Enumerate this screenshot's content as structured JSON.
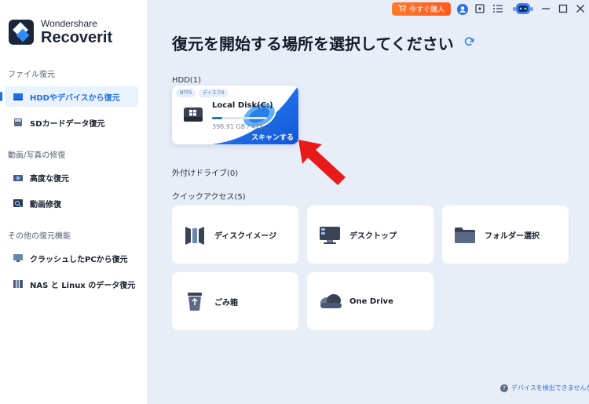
{
  "brand": {
    "line1": "Wondershare",
    "line2": "Recoverit"
  },
  "sidebar": {
    "sections": [
      {
        "title": "ファイル復元"
      },
      {
        "title": "動画/写真の修復"
      },
      {
        "title": "その他の復元機能"
      }
    ],
    "items": [
      {
        "label": "HDDやデバイスから復元",
        "icon": "hard-drive-icon",
        "active": true
      },
      {
        "label": "SDカードデータ復元",
        "icon": "sd-card-icon"
      },
      {
        "label": "高度な復元",
        "icon": "camera-icon"
      },
      {
        "label": "動画修復",
        "icon": "video-repair-icon"
      },
      {
        "label": "クラッシュしたPCから復元",
        "icon": "monitor-icon"
      },
      {
        "label": "NAS と Linux のデータ復元",
        "icon": "nas-icon"
      }
    ]
  },
  "topbar": {
    "buy_label": "今すぐ購入"
  },
  "main": {
    "title": "復元を開始する場所を選択してください",
    "hdd_label": "HDD(1)",
    "disk": {
      "tags": [
        "NTFS",
        "ディスク0"
      ],
      "name": "Local Disk(C:)",
      "size": "398.91 GB / 475...",
      "scan_label": "スキャンする"
    },
    "external_label": "外付けドライブ(0)",
    "quick_label": "クイックアクセス(5)",
    "quick_items": [
      {
        "label": "ディスクイメージ",
        "icon": "disk-image-icon"
      },
      {
        "label": "デスクトップ",
        "icon": "desktop-icon"
      },
      {
        "label": "フォルダー選択",
        "icon": "folder-icon"
      },
      {
        "label": "ごみ箱",
        "icon": "trash-icon"
      },
      {
        "label": "One Drive",
        "icon": "cloud-icon"
      }
    ],
    "help_link": "デバイスを検出できませんか？"
  },
  "colors": {
    "accent": "#1f6fe5",
    "buy": "#ff6a24",
    "arrow": "#e81b1b"
  }
}
